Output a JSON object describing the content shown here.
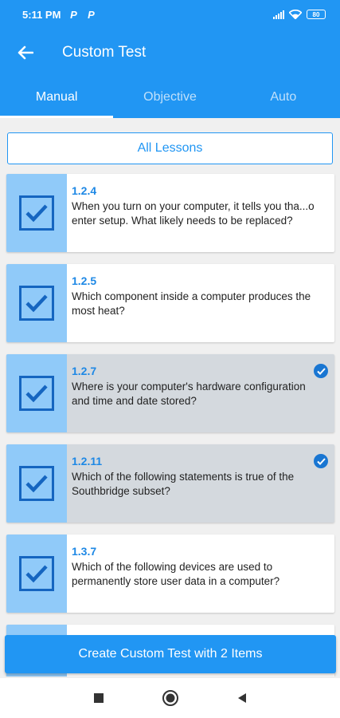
{
  "status_bar": {
    "time": "5:11 PM",
    "notification_icons": [
      "P",
      "P"
    ],
    "battery": "80"
  },
  "app_bar": {
    "title": "Custom Test",
    "back_icon": "arrow-left-icon"
  },
  "tabs": [
    {
      "label": "Manual",
      "active": true
    },
    {
      "label": "Objective",
      "active": false
    },
    {
      "label": "Auto",
      "active": false
    }
  ],
  "lessons_button": {
    "label": "All Lessons"
  },
  "questions": [
    {
      "id": "1.2.4",
      "text": "When you turn on your computer, it tells you tha...o enter setup. What likely needs to be replaced?",
      "selected": false
    },
    {
      "id": "1.2.5",
      "text": "Which component inside a computer produces the most heat?",
      "selected": false
    },
    {
      "id": "1.2.7",
      "text": "Where is your computer's hardware configuration and time and date stored?",
      "selected": true
    },
    {
      "id": "1.2.11",
      "text": "Which of the following statements is true of the Southbridge subset?",
      "selected": true
    },
    {
      "id": "1.3.7",
      "text": "Which of the following devices are used to permanently store user data in a computer?",
      "selected": false
    }
  ],
  "create_button": {
    "label": "Create Custom Test with 2 Items"
  },
  "colors": {
    "primary": "#2196f3",
    "check_panel": "#90caf9",
    "check_mark": "#1565c0",
    "selected_card": "#d4d9de"
  },
  "nav_icons": [
    "square-icon",
    "circle-icon",
    "triangle-back-icon"
  ]
}
